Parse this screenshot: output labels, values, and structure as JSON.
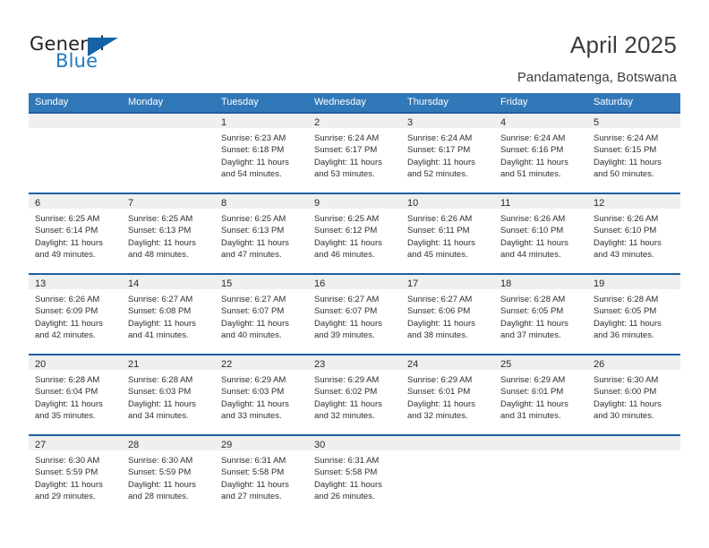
{
  "brand": {
    "name_top": "General",
    "name_bottom": "Blue",
    "triangle_color": "#1464a5",
    "blue_color": "#1f7bc1"
  },
  "header": {
    "title": "April 2025",
    "subtitle": "Pandamatenga, Botswana"
  },
  "theme": {
    "header_blue": "#3178b8",
    "rule_blue": "#1f5f9e",
    "date_strip_gray": "#efefef"
  },
  "weekdays": [
    "Sunday",
    "Monday",
    "Tuesday",
    "Wednesday",
    "Thursday",
    "Friday",
    "Saturday"
  ],
  "weeks": [
    [
      {
        "day": "",
        "sunrise": "",
        "sunset": "",
        "daylight_1": "",
        "daylight_2": "",
        "blank": true
      },
      {
        "day": "",
        "sunrise": "",
        "sunset": "",
        "daylight_1": "",
        "daylight_2": "",
        "blank": true
      },
      {
        "day": "1",
        "sunrise": "Sunrise: 6:23 AM",
        "sunset": "Sunset: 6:18 PM",
        "daylight_1": "Daylight: 11 hours",
        "daylight_2": "and 54 minutes."
      },
      {
        "day": "2",
        "sunrise": "Sunrise: 6:24 AM",
        "sunset": "Sunset: 6:17 PM",
        "daylight_1": "Daylight: 11 hours",
        "daylight_2": "and 53 minutes."
      },
      {
        "day": "3",
        "sunrise": "Sunrise: 6:24 AM",
        "sunset": "Sunset: 6:17 PM",
        "daylight_1": "Daylight: 11 hours",
        "daylight_2": "and 52 minutes."
      },
      {
        "day": "4",
        "sunrise": "Sunrise: 6:24 AM",
        "sunset": "Sunset: 6:16 PM",
        "daylight_1": "Daylight: 11 hours",
        "daylight_2": "and 51 minutes."
      },
      {
        "day": "5",
        "sunrise": "Sunrise: 6:24 AM",
        "sunset": "Sunset: 6:15 PM",
        "daylight_1": "Daylight: 11 hours",
        "daylight_2": "and 50 minutes."
      }
    ],
    [
      {
        "day": "6",
        "sunrise": "Sunrise: 6:25 AM",
        "sunset": "Sunset: 6:14 PM",
        "daylight_1": "Daylight: 11 hours",
        "daylight_2": "and 49 minutes."
      },
      {
        "day": "7",
        "sunrise": "Sunrise: 6:25 AM",
        "sunset": "Sunset: 6:13 PM",
        "daylight_1": "Daylight: 11 hours",
        "daylight_2": "and 48 minutes."
      },
      {
        "day": "8",
        "sunrise": "Sunrise: 6:25 AM",
        "sunset": "Sunset: 6:13 PM",
        "daylight_1": "Daylight: 11 hours",
        "daylight_2": "and 47 minutes."
      },
      {
        "day": "9",
        "sunrise": "Sunrise: 6:25 AM",
        "sunset": "Sunset: 6:12 PM",
        "daylight_1": "Daylight: 11 hours",
        "daylight_2": "and 46 minutes."
      },
      {
        "day": "10",
        "sunrise": "Sunrise: 6:26 AM",
        "sunset": "Sunset: 6:11 PM",
        "daylight_1": "Daylight: 11 hours",
        "daylight_2": "and 45 minutes."
      },
      {
        "day": "11",
        "sunrise": "Sunrise: 6:26 AM",
        "sunset": "Sunset: 6:10 PM",
        "daylight_1": "Daylight: 11 hours",
        "daylight_2": "and 44 minutes."
      },
      {
        "day": "12",
        "sunrise": "Sunrise: 6:26 AM",
        "sunset": "Sunset: 6:10 PM",
        "daylight_1": "Daylight: 11 hours",
        "daylight_2": "and 43 minutes."
      }
    ],
    [
      {
        "day": "13",
        "sunrise": "Sunrise: 6:26 AM",
        "sunset": "Sunset: 6:09 PM",
        "daylight_1": "Daylight: 11 hours",
        "daylight_2": "and 42 minutes."
      },
      {
        "day": "14",
        "sunrise": "Sunrise: 6:27 AM",
        "sunset": "Sunset: 6:08 PM",
        "daylight_1": "Daylight: 11 hours",
        "daylight_2": "and 41 minutes."
      },
      {
        "day": "15",
        "sunrise": "Sunrise: 6:27 AM",
        "sunset": "Sunset: 6:07 PM",
        "daylight_1": "Daylight: 11 hours",
        "daylight_2": "and 40 minutes."
      },
      {
        "day": "16",
        "sunrise": "Sunrise: 6:27 AM",
        "sunset": "Sunset: 6:07 PM",
        "daylight_1": "Daylight: 11 hours",
        "daylight_2": "and 39 minutes."
      },
      {
        "day": "17",
        "sunrise": "Sunrise: 6:27 AM",
        "sunset": "Sunset: 6:06 PM",
        "daylight_1": "Daylight: 11 hours",
        "daylight_2": "and 38 minutes."
      },
      {
        "day": "18",
        "sunrise": "Sunrise: 6:28 AM",
        "sunset": "Sunset: 6:05 PM",
        "daylight_1": "Daylight: 11 hours",
        "daylight_2": "and 37 minutes."
      },
      {
        "day": "19",
        "sunrise": "Sunrise: 6:28 AM",
        "sunset": "Sunset: 6:05 PM",
        "daylight_1": "Daylight: 11 hours",
        "daylight_2": "and 36 minutes."
      }
    ],
    [
      {
        "day": "20",
        "sunrise": "Sunrise: 6:28 AM",
        "sunset": "Sunset: 6:04 PM",
        "daylight_1": "Daylight: 11 hours",
        "daylight_2": "and 35 minutes."
      },
      {
        "day": "21",
        "sunrise": "Sunrise: 6:28 AM",
        "sunset": "Sunset: 6:03 PM",
        "daylight_1": "Daylight: 11 hours",
        "daylight_2": "and 34 minutes."
      },
      {
        "day": "22",
        "sunrise": "Sunrise: 6:29 AM",
        "sunset": "Sunset: 6:03 PM",
        "daylight_1": "Daylight: 11 hours",
        "daylight_2": "and 33 minutes."
      },
      {
        "day": "23",
        "sunrise": "Sunrise: 6:29 AM",
        "sunset": "Sunset: 6:02 PM",
        "daylight_1": "Daylight: 11 hours",
        "daylight_2": "and 32 minutes."
      },
      {
        "day": "24",
        "sunrise": "Sunrise: 6:29 AM",
        "sunset": "Sunset: 6:01 PM",
        "daylight_1": "Daylight: 11 hours",
        "daylight_2": "and 32 minutes."
      },
      {
        "day": "25",
        "sunrise": "Sunrise: 6:29 AM",
        "sunset": "Sunset: 6:01 PM",
        "daylight_1": "Daylight: 11 hours",
        "daylight_2": "and 31 minutes."
      },
      {
        "day": "26",
        "sunrise": "Sunrise: 6:30 AM",
        "sunset": "Sunset: 6:00 PM",
        "daylight_1": "Daylight: 11 hours",
        "daylight_2": "and 30 minutes."
      }
    ],
    [
      {
        "day": "27",
        "sunrise": "Sunrise: 6:30 AM",
        "sunset": "Sunset: 5:59 PM",
        "daylight_1": "Daylight: 11 hours",
        "daylight_2": "and 29 minutes."
      },
      {
        "day": "28",
        "sunrise": "Sunrise: 6:30 AM",
        "sunset": "Sunset: 5:59 PM",
        "daylight_1": "Daylight: 11 hours",
        "daylight_2": "and 28 minutes."
      },
      {
        "day": "29",
        "sunrise": "Sunrise: 6:31 AM",
        "sunset": "Sunset: 5:58 PM",
        "daylight_1": "Daylight: 11 hours",
        "daylight_2": "and 27 minutes."
      },
      {
        "day": "30",
        "sunrise": "Sunrise: 6:31 AM",
        "sunset": "Sunset: 5:58 PM",
        "daylight_1": "Daylight: 11 hours",
        "daylight_2": "and 26 minutes."
      },
      {
        "day": "",
        "sunrise": "",
        "sunset": "",
        "daylight_1": "",
        "daylight_2": "",
        "blank": true
      },
      {
        "day": "",
        "sunrise": "",
        "sunset": "",
        "daylight_1": "",
        "daylight_2": "",
        "blank": true
      },
      {
        "day": "",
        "sunrise": "",
        "sunset": "",
        "daylight_1": "",
        "daylight_2": "",
        "blank": true
      }
    ]
  ]
}
